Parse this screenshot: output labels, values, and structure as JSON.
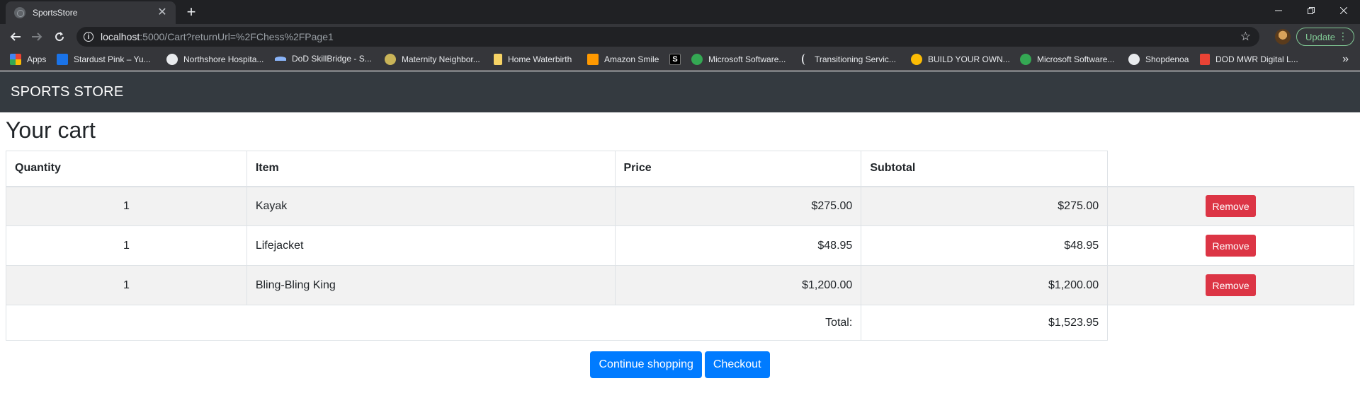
{
  "browser": {
    "tab_title": "SportsStore",
    "tab_close": "✕",
    "new_tab": "+",
    "url_host": "localhost",
    "url_rest": ":5000/Cart?returnUrl=%2FChess%2FPage1",
    "update_label": "Update",
    "bookmarks": [
      {
        "label": "Apps",
        "icon": "apps-grid-icon",
        "color": "#ea4335"
      },
      {
        "label": "Stardust Pink – Yu...",
        "icon": "stardust-icon",
        "color": "#1a73e8"
      },
      {
        "label": "Northshore Hospita...",
        "icon": "globe-icon",
        "color": "#e8eaed"
      },
      {
        "label": "DoD SkillBridge - S...",
        "icon": "skillbridge-icon",
        "color": "#8ab4f8"
      },
      {
        "label": "Maternity Neighbor...",
        "icon": "sun-icon",
        "color": "#c9b458"
      },
      {
        "label": "Home Waterbirth",
        "icon": "folder-icon",
        "color": "#f6d365"
      },
      {
        "label": "Amazon Smile",
        "icon": "amazon-icon",
        "color": "#ff9900"
      },
      {
        "label": "",
        "icon": "s-icon",
        "color": "#000000"
      },
      {
        "label": "Microsoft Software...",
        "icon": "microsoft-icon",
        "color": "#34a853"
      },
      {
        "label": "Transitioning Servic...",
        "icon": "bracket-icon",
        "color": "#e8eaed"
      },
      {
        "label": "BUILD YOUR OWN...",
        "icon": "lemon-icon",
        "color": "#fbbc04"
      },
      {
        "label": "Microsoft Software...",
        "icon": "microsoft-icon",
        "color": "#34a853"
      },
      {
        "label": "Shopdenoa",
        "icon": "globe-icon",
        "color": "#e8eaed"
      },
      {
        "label": "DOD MWR Digital L...",
        "icon": "mwr-icon",
        "color": "#ea4335"
      }
    ]
  },
  "site": {
    "brand": "SPORTS STORE"
  },
  "cart": {
    "title": "Your cart",
    "headers": {
      "quantity": "Quantity",
      "item": "Item",
      "price": "Price",
      "subtotal": "Subtotal"
    },
    "rows": [
      {
        "quantity": "1",
        "item": "Kayak",
        "price": "$275.00",
        "subtotal": "$275.00",
        "action": "Remove"
      },
      {
        "quantity": "1",
        "item": "Lifejacket",
        "price": "$48.95",
        "subtotal": "$48.95",
        "action": "Remove"
      },
      {
        "quantity": "1",
        "item": "Bling-Bling King",
        "price": "$1,200.00",
        "subtotal": "$1,200.00",
        "action": "Remove"
      }
    ],
    "total_label": "Total:",
    "total_value": "$1,523.95",
    "continue_label": "Continue shopping",
    "checkout_label": "Checkout"
  },
  "colors": {
    "navbar": "#343a40",
    "remove": "#dc3545",
    "primary": "#007bff"
  }
}
